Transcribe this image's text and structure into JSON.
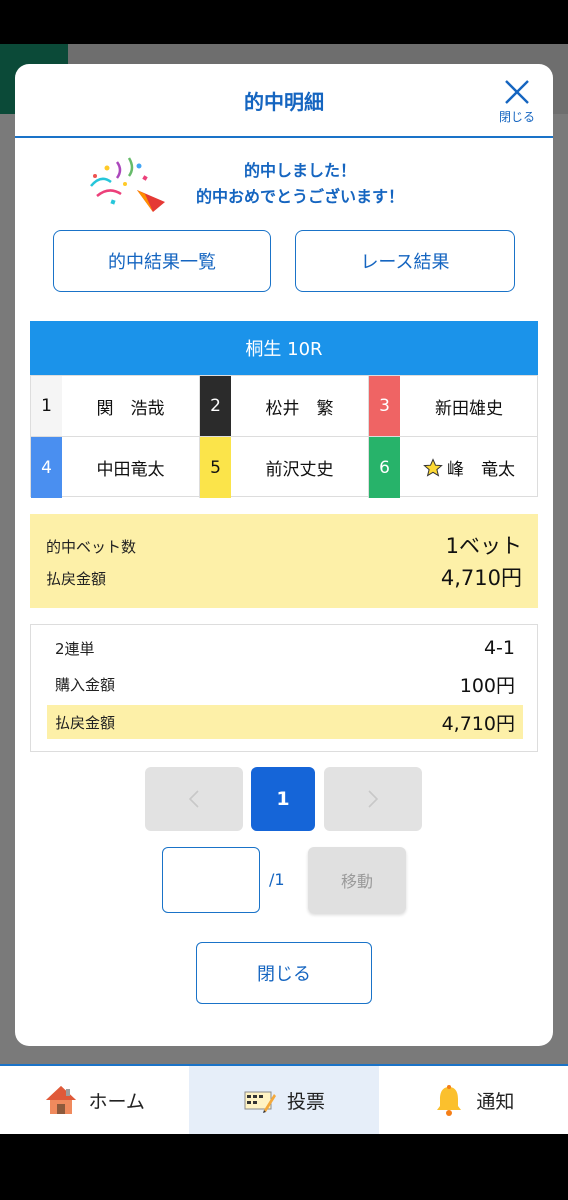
{
  "modal": {
    "title": "的中明細",
    "close_label": "閉じる"
  },
  "congrats": {
    "line1": "的中しました！",
    "line2": "的中おめでとうございます！"
  },
  "buttons": {
    "hit_list": "的中結果一覧",
    "race_result": "レース結果"
  },
  "race": {
    "title": "桐生 10R",
    "racers": [
      {
        "no": "1",
        "name": "関　浩哉",
        "color": "#f5f5f5",
        "text_color": "#111111"
      },
      {
        "no": "2",
        "name": "松井　繁",
        "color": "#2b2b2b",
        "text_color": "#ffffff"
      },
      {
        "no": "3",
        "name": "新田雄史",
        "color": "#ef6464",
        "text_color": "#ffffff"
      },
      {
        "no": "4",
        "name": "中田竜太",
        "color": "#4a8ff0",
        "text_color": "#ffffff"
      },
      {
        "no": "5",
        "name": "前沢丈史",
        "color": "#fbe44a",
        "text_color": "#111111"
      },
      {
        "no": "6",
        "name": "峰　竜太",
        "color": "#27b36a",
        "text_color": "#ffffff",
        "star": true
      }
    ]
  },
  "summary": {
    "bet_count_label": "的中ベット数",
    "bet_count_value": "1ベット",
    "payout_label": "払戻金額",
    "payout_value": "4,710円"
  },
  "detail": {
    "type_label": "2連単",
    "type_value": "4-1",
    "purchase_label": "購入金額",
    "purchase_value": "100円",
    "payout_label": "払戻金額",
    "payout_value": "4,710円"
  },
  "pager": {
    "current": "1",
    "total": "/1",
    "input_value": "",
    "move_label": "移動"
  },
  "close_button": "閉じる",
  "nav": {
    "home": "ホーム",
    "vote": "投票",
    "notify": "通知"
  },
  "colors": {
    "accent": "#1565c0",
    "race_header": "#1b93ea",
    "highlight": "#fdf0a8"
  }
}
